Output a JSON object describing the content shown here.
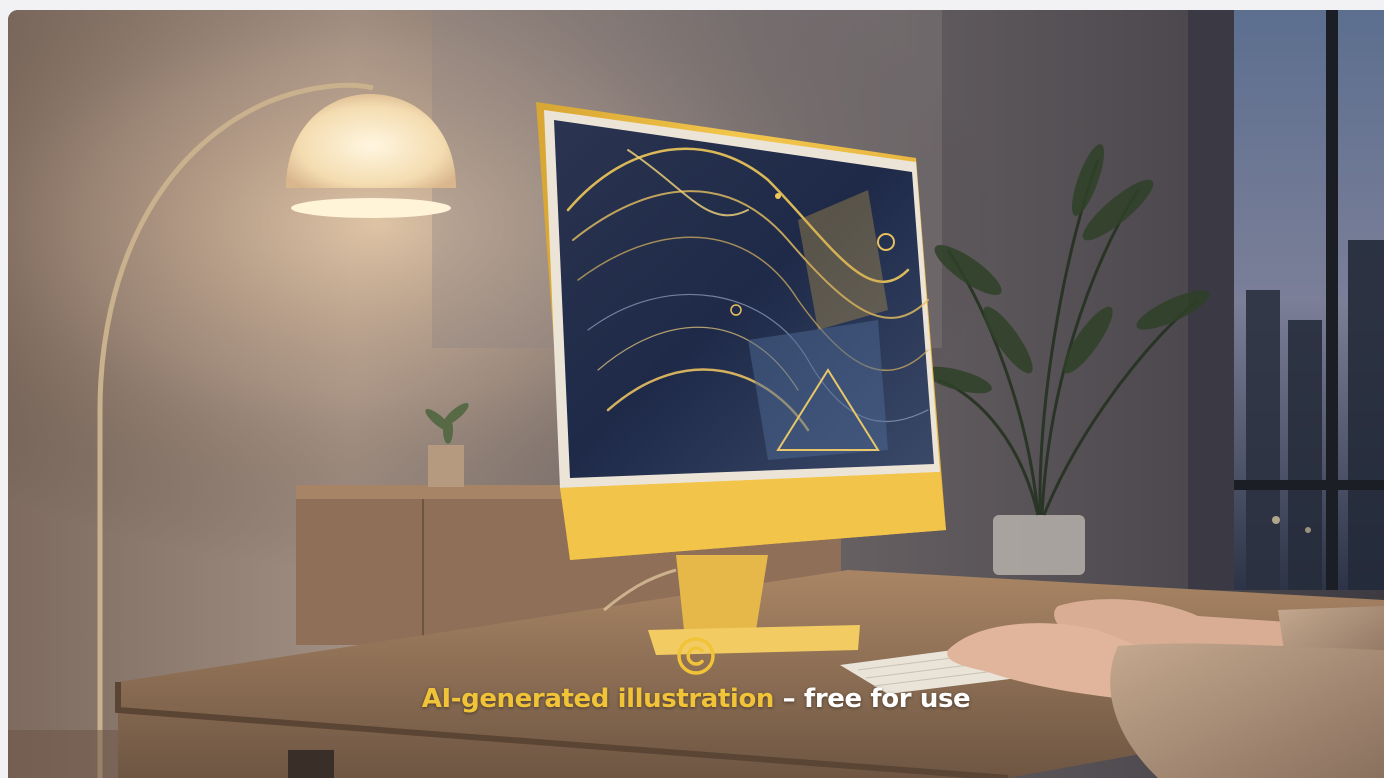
{
  "caption": {
    "highlight": "AI-generated illustration",
    "rest": " – free for use"
  },
  "colors": {
    "accent": "#f1c338",
    "caption_text": "#ffffff",
    "monitor_body": "#f1c54b",
    "page_background": "#f2f2f4"
  },
  "icons": {
    "copyright": "copyright-icon"
  }
}
